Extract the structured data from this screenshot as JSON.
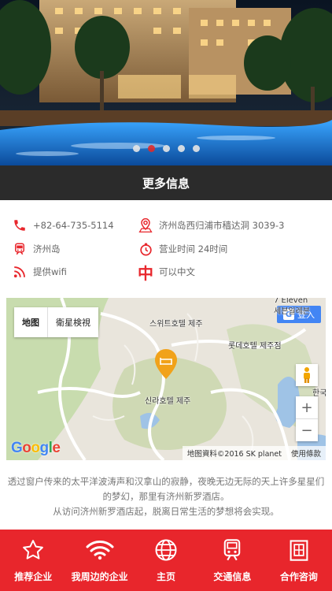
{
  "hero": {
    "slide_count": 5,
    "active_slide": 1
  },
  "section": {
    "title": "更多信息"
  },
  "info": {
    "phone": "+82-64-735-5114",
    "address": "济州岛西归浦市穑达洞 3039-3",
    "transport": "济州岛",
    "hours": "营业时间 24时间",
    "wifi": "提供wifi",
    "language": "可以中文",
    "language_badge": "中"
  },
  "map": {
    "tabs": [
      "地图",
      "衛星検視"
    ],
    "login": "登入",
    "login_g": "G",
    "labels": {
      "suite": "스위트호텔 제주",
      "lotte": "롯데호텔 제주점",
      "shilla": "신라호텔 제주",
      "eleven": "7 Eleven",
      "road": "세븐일레븐",
      "han": "한국"
    },
    "zoom_in": "+",
    "zoom_out": "−",
    "attribution": "地图資料©2016 SK planet",
    "terms": "使用條款",
    "google": [
      "G",
      "o",
      "o",
      "g",
      "l",
      "e"
    ]
  },
  "description": {
    "line1": "透过窗户传来的太平洋波涛声和汉拿山的寂静，夜晚无边无际的天上许多星星们的梦幻，那里有济州新罗酒店。",
    "line2": "从访问济州新罗酒店起，脱离日常生活的梦想将会实现。"
  },
  "nav": [
    {
      "label": "推荐企业",
      "icon": "star-icon"
    },
    {
      "label": "我周边的企业",
      "icon": "wifi-icon"
    },
    {
      "label": "主页",
      "icon": "globe-icon"
    },
    {
      "label": "交通信息",
      "icon": "train-icon"
    },
    {
      "label": "合作咨询",
      "icon": "building-icon"
    }
  ],
  "colors": {
    "accent": "#e8262c",
    "header_bar": "#2b2b2b",
    "active_dot": "#e02a2a"
  }
}
